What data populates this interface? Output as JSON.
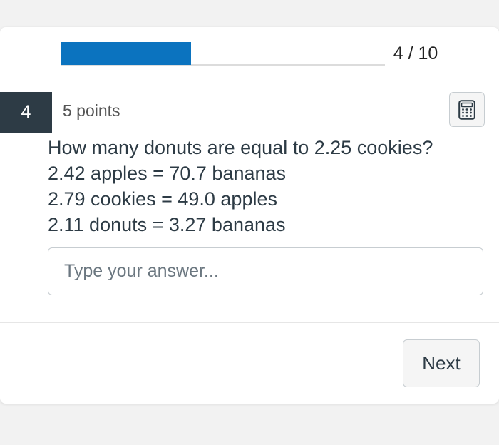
{
  "progress": {
    "count_label": "4 / 10",
    "fraction": 0.4,
    "fill_color": "#0b73bf"
  },
  "question": {
    "number": "4",
    "points": "5 points",
    "calculator_icon": "calculator-icon",
    "lines": [
      "How many donuts are equal to 2.25 cookies?",
      "2.42 apples = 70.7 bananas",
      "2.79 cookies = 49.0 apples",
      "2.11 donuts = 3.27 bananas"
    ]
  },
  "answer": {
    "value": "",
    "placeholder": "Type your answer..."
  },
  "footer": {
    "next_label": "Next"
  },
  "colors": {
    "number_badge_bg": "#2d3b45",
    "text": "#2d3b45"
  }
}
